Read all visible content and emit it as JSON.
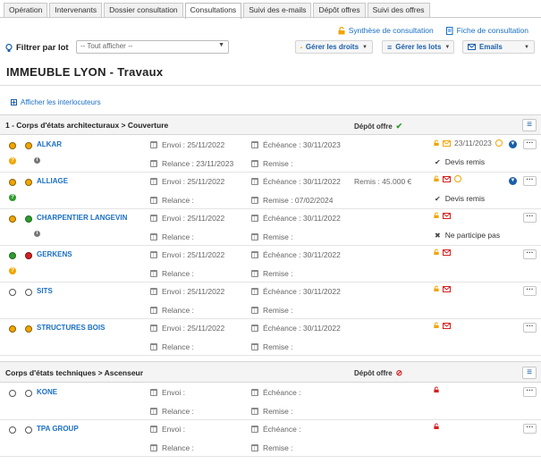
{
  "tabs": [
    "Opération",
    "Intervenants",
    "Dossier consultation",
    "Consultations",
    "Suivi des e-mails",
    "Dépôt offres",
    "Suivi des offres"
  ],
  "active_tab": "Consultations",
  "toplinks": {
    "synthese": "Synthèse de consultation",
    "fiche": "Fiche de consultation"
  },
  "filter": {
    "label": "Filtrer par lot",
    "value": "-- Tout afficher --"
  },
  "toolbar": {
    "droits": "Gérer les droits",
    "lots": "Gérer les lots",
    "emails": "Emails"
  },
  "title": "IMMEUBLE LYON - Travaux",
  "show_interlocutors": "Afficher les interlocuteurs",
  "groups": [
    {
      "title": "1 - Corps d'états architecturaux > Couverture",
      "status": "Dépôt offre",
      "rows": [
        {
          "name": "ALKAR",
          "envoi": "Envoi : 25/11/2022",
          "echeance": "Échéance : 30/11/2023",
          "relance": "Relance : 23/11/2023",
          "remise": "Remise :",
          "remis": "",
          "date": "23/11/2023",
          "status": "Devis remis"
        },
        {
          "name": "ALLIAGE",
          "envoi": "Envoi : 25/11/2022",
          "echeance": "Échéance : 30/11/2022",
          "relance": "Relance :",
          "remise": "Remise : 07/02/2024",
          "remis": "Remis : 45.000 €",
          "date": "",
          "status": "Devis remis"
        },
        {
          "name": "CHARPENTIER LANGEVIN",
          "envoi": "Envoi : 25/11/2022",
          "echeance": "Échéance : 30/11/2022",
          "relance": "Relance :",
          "remise": "Remise :",
          "remis": "",
          "date": "",
          "status": "Ne participe pas"
        },
        {
          "name": "GERKENS",
          "envoi": "Envoi : 25/11/2022",
          "echeance": "Échéance : 30/11/2022",
          "relance": "Relance :",
          "remise": "Remise :",
          "remis": "",
          "date": "",
          "status": ""
        },
        {
          "name": "SITS",
          "envoi": "Envoi : 25/11/2022",
          "echeance": "Échéance : 30/11/2022",
          "relance": "Relance :",
          "remise": "Remise :",
          "remis": "",
          "date": "",
          "status": ""
        },
        {
          "name": "STRUCTURES BOIS",
          "envoi": "Envoi : 25/11/2022",
          "echeance": "Échéance : 30/11/2022",
          "relance": "Relance :",
          "remise": "Remise :",
          "remis": "",
          "date": "",
          "status": ""
        }
      ]
    },
    {
      "title": "Corps d'états techniques > Ascenseur",
      "status": "Dépôt offre",
      "rows": [
        {
          "name": "KONE",
          "envoi": "Envoi :",
          "echeance": "Échéance :",
          "relance": "Relance :",
          "remise": "Remise :",
          "remis": "",
          "date": "",
          "status": ""
        },
        {
          "name": "TPA GROUP",
          "envoi": "Envoi :",
          "echeance": "Échéance :",
          "relance": "Relance :",
          "remise": "Remise :",
          "remis": "",
          "date": "",
          "status": ""
        }
      ]
    }
  ],
  "colors": {
    "link": "#1a6fc4",
    "orange": "#f0a500",
    "green": "#2e9b2e",
    "red": "#d42020"
  }
}
